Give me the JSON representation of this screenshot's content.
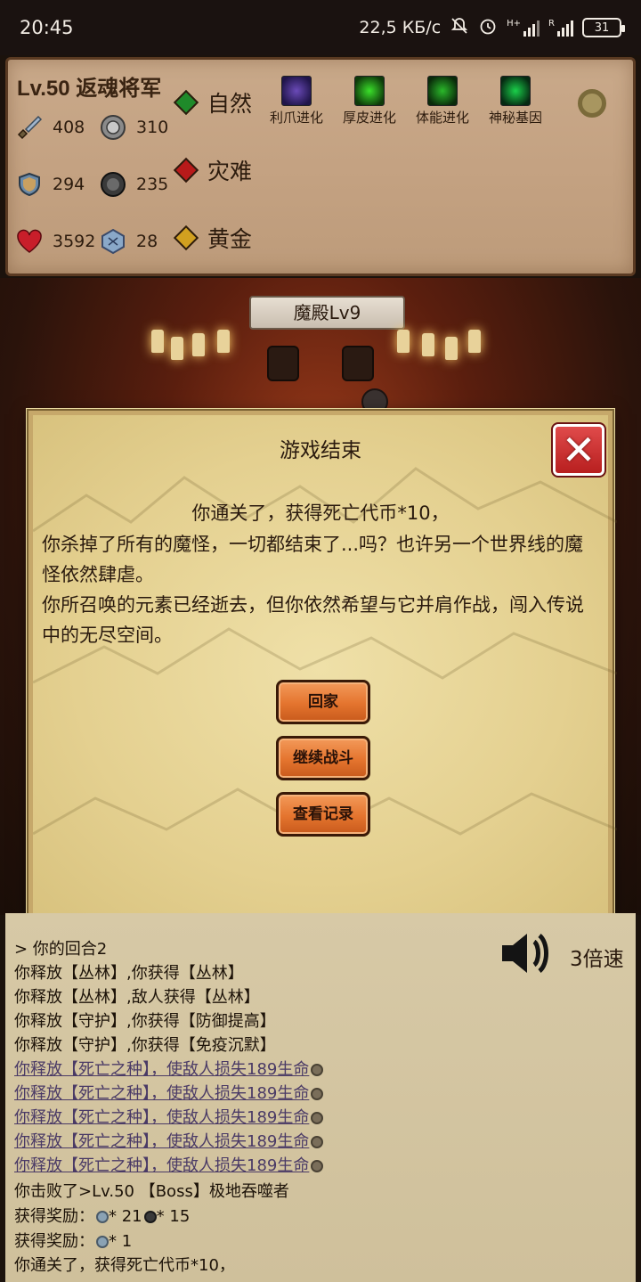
{
  "status_bar": {
    "time": "20:45",
    "net_speed": "22,5 КБ/с",
    "battery": "31",
    "icons": [
      "mute-bell-icon",
      "alarm-icon",
      "signal-h-plus-icon",
      "signal-r-icon",
      "battery-icon"
    ]
  },
  "player": {
    "title": "Lv.50 返魂将军",
    "stats": [
      {
        "icon": "sword-icon",
        "value": "408"
      },
      {
        "icon": "round-shield-coin-icon",
        "value": "310"
      },
      {
        "icon": "shield-icon",
        "value": "294"
      },
      {
        "icon": "dark-coin-icon",
        "value": "235"
      },
      {
        "icon": "heart-icon",
        "value": "3592"
      },
      {
        "icon": "blue-rune-icon",
        "value": "28"
      }
    ],
    "elements": [
      {
        "label": "自然",
        "color": "#1f8a2a"
      },
      {
        "label": "灾难",
        "color": "#b81a1a"
      },
      {
        "label": "黄金",
        "color": "#d1a020"
      }
    ],
    "evolutions": [
      {
        "label": "利爪进化",
        "icon": "claw-evolution-icon"
      },
      {
        "label": "厚皮进化",
        "icon": "thick-skin-evolution-icon"
      },
      {
        "label": "体能进化",
        "icon": "stamina-evolution-icon"
      },
      {
        "label": "神秘基因",
        "icon": "mystery-gene-icon"
      }
    ]
  },
  "scene": {
    "banner": "魔殿Lv9"
  },
  "dialog": {
    "title": "游戏结束",
    "lead": "你通关了，获得死亡代币*10，",
    "body": [
      "你杀掉了所有的魔怪，一切都结束了...吗？也许另一个世界线的魔怪依然肆虐。",
      "你所召唤的元素已经逝去，但你依然希望与它并肩作战，闯入传说中的无尽空间。"
    ],
    "buttons": {
      "home": "回家",
      "continue": "继续战斗",
      "records": "查看记录"
    }
  },
  "log": {
    "speed": "3倍速",
    "lines": [
      {
        "text": "> 你的回合2",
        "link": false
      },
      {
        "text": "你释放【丛林】,你获得【丛林】",
        "link": false
      },
      {
        "text": "你释放【丛林】,敌人获得【丛林】",
        "link": false
      },
      {
        "text": "你释放【守护】,你获得【防御提高】",
        "link": false
      },
      {
        "text": "你释放【守护】,你获得【免疫沉默】",
        "link": false
      },
      {
        "text": "你释放【死亡之种】，使敌人损失189生命",
        "link": true
      },
      {
        "text": "你释放【死亡之种】，使敌人损失189生命",
        "link": true
      },
      {
        "text": "你释放【死亡之种】，使敌人损失189生命",
        "link": true
      },
      {
        "text": "你释放【死亡之种】，使敌人损失189生命",
        "link": true
      },
      {
        "text": "你释放【死亡之种】，使敌人损失189生命",
        "link": true
      },
      {
        "text": "你击败了>Lv.50 【Boss】极地吞噬者",
        "link": false
      },
      {
        "text": "获得奖励：",
        "link": false,
        "rewards": [
          "* 21",
          "* 15"
        ]
      },
      {
        "text": "获得奖励：",
        "link": false,
        "rewards": [
          "* 1"
        ]
      },
      {
        "text": "你通关了，获得死亡代币*10，",
        "link": false
      }
    ]
  }
}
